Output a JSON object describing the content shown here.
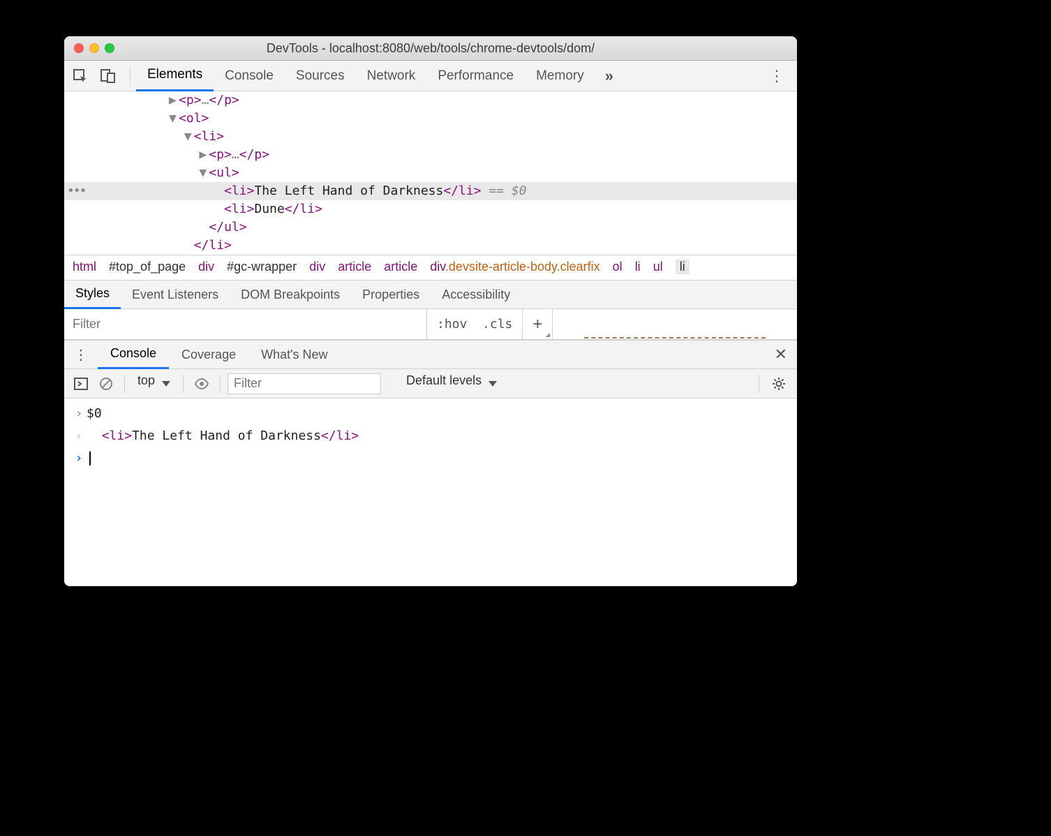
{
  "window": {
    "title": "DevTools - localhost:8080/web/tools/chrome-devtools/dom/"
  },
  "tabs": {
    "items": [
      "Elements",
      "Console",
      "Sources",
      "Network",
      "Performance",
      "Memory"
    ],
    "activeIndex": 0
  },
  "dom": {
    "lines": [
      {
        "indent": 12,
        "arrow": "▶",
        "html": "<p>…</p>"
      },
      {
        "indent": 12,
        "arrow": "▼",
        "html": "<ol>"
      },
      {
        "indent": 14,
        "arrow": "▼",
        "html": "<li>"
      },
      {
        "indent": 16,
        "arrow": "▶",
        "html": "<p>…</p>"
      },
      {
        "indent": 16,
        "arrow": "▼",
        "html": "<ul>"
      },
      {
        "indent": 18,
        "arrow": "",
        "html": "<li>The Left Hand of Darkness</li>",
        "selected": true,
        "suffix": " == $0"
      },
      {
        "indent": 18,
        "arrow": "",
        "html": "<li>Dune</li>"
      },
      {
        "indent": 16,
        "arrow": "",
        "html": "</ul>"
      },
      {
        "indent": 14,
        "arrow": "",
        "html": "</li>"
      }
    ]
  },
  "breadcrumb": {
    "items": [
      {
        "text": "html"
      },
      {
        "text": "#top_of_page",
        "id": true
      },
      {
        "text": "div"
      },
      {
        "text": "#gc-wrapper",
        "id": true
      },
      {
        "text": "div"
      },
      {
        "text": "article"
      },
      {
        "text": "article"
      },
      {
        "text": "div.devsite-article-body.clearfix",
        "orange": true
      },
      {
        "text": "ol"
      },
      {
        "text": "li"
      },
      {
        "text": "ul"
      },
      {
        "text": "li",
        "last": true
      }
    ]
  },
  "stylesTabs": {
    "items": [
      "Styles",
      "Event Listeners",
      "DOM Breakpoints",
      "Properties",
      "Accessibility"
    ],
    "activeIndex": 0
  },
  "stylesFilter": {
    "placeholder": "Filter",
    "hov": ":hov",
    "cls": ".cls"
  },
  "drawer": {
    "tabs": [
      "Console",
      "Coverage",
      "What's New"
    ],
    "activeIndex": 0
  },
  "consoleToolbar": {
    "context": "top",
    "filterPlaceholder": "Filter",
    "levels": "Default levels"
  },
  "console": {
    "input": "$0",
    "outputTag": "li",
    "outputText": "The Left Hand of Darkness"
  }
}
